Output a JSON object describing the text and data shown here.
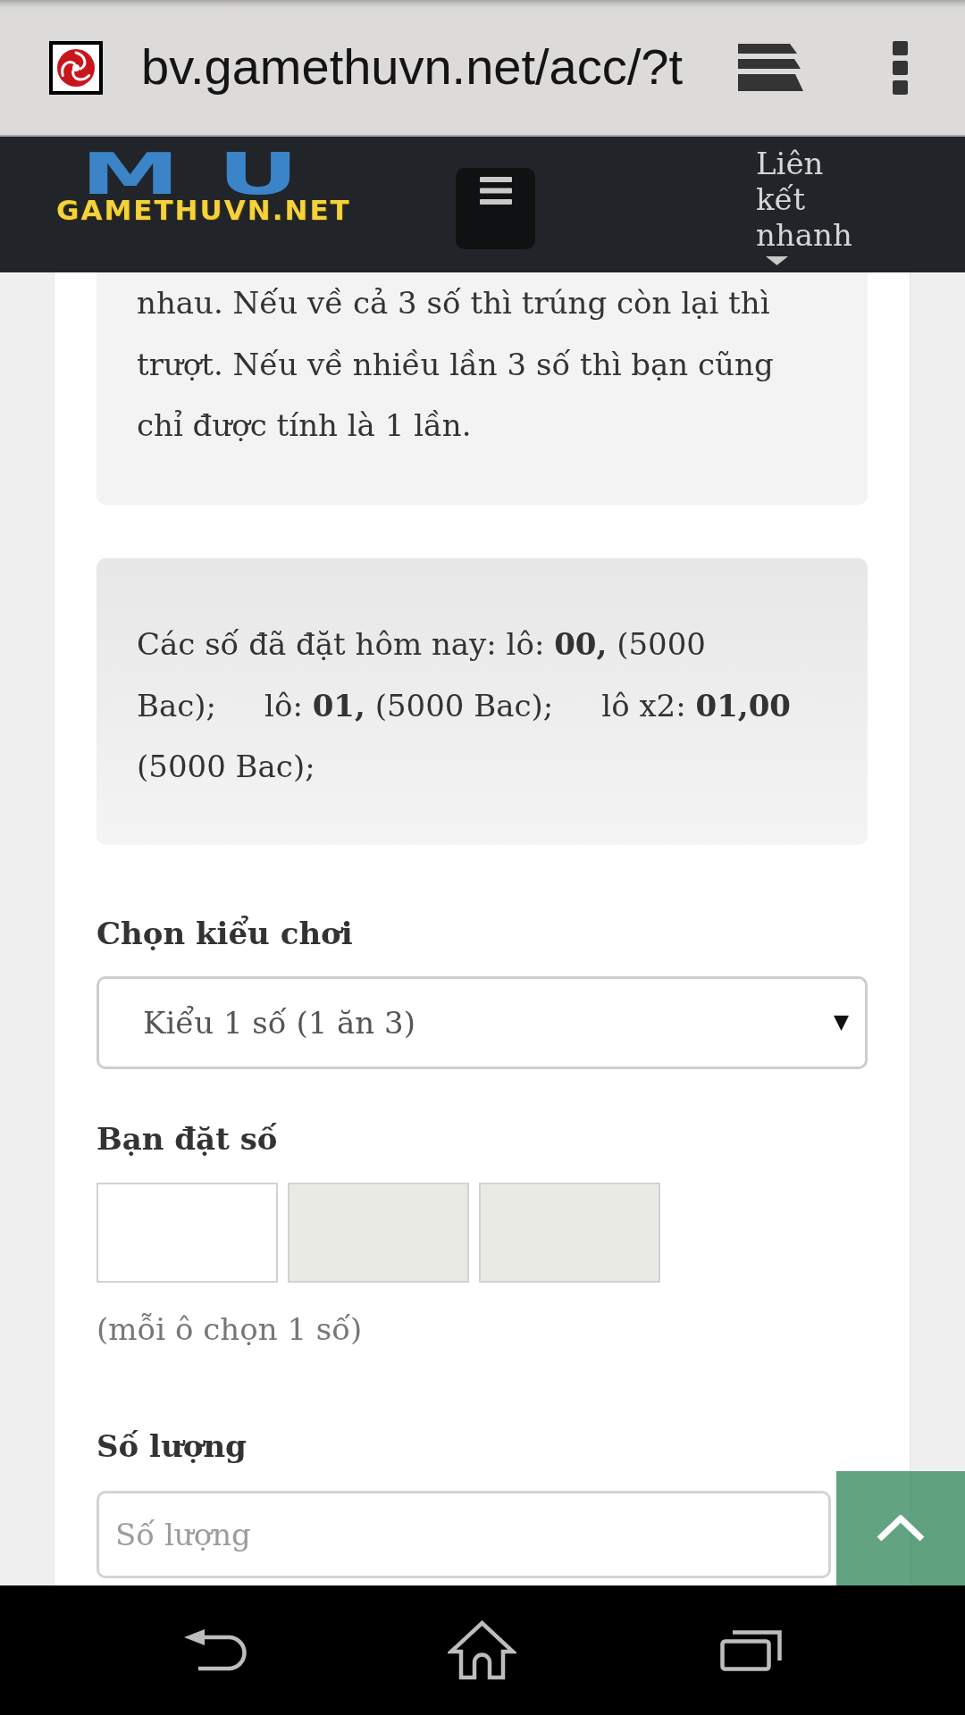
{
  "browser": {
    "url": "bv.gamethuvn.net/acc/?t"
  },
  "navbar": {
    "logo": {
      "backdrop_text": "MU",
      "text": "GAMETHUVN.NET"
    },
    "link": "Liên kết nhanh"
  },
  "notices": [
    {
      "kind": "rules",
      "text": "nhau. Nếu về cả 3 số thì trúng còn lại thì trượt. Nếu về nhiều lần 3 số thì bạn cũng chỉ được tính là 1 lần."
    },
    {
      "kind": "bets",
      "text": "Các số đã đặt hôm nay: lô: **00,** (5000 Bac);     lô: **01,** (5000 Bac);     lô x2: **01,00** (5000 Bac);"
    }
  ],
  "form": {
    "fields": [
      {
        "kind": "select",
        "label": "Chọn kiểu chơi",
        "value": "Kiểu 1 số (1 ăn 3)"
      },
      {
        "kind": "digit_boxes",
        "label": "Bạn đặt số",
        "boxes": [
          {
            "disabled": false
          },
          {
            "disabled": true
          },
          {
            "disabled": true
          }
        ],
        "hint": "(mỗi ô chọn 1 số)"
      },
      {
        "kind": "text",
        "label": "Số lượng",
        "placeholder": "Số lượng"
      }
    ]
  }
}
